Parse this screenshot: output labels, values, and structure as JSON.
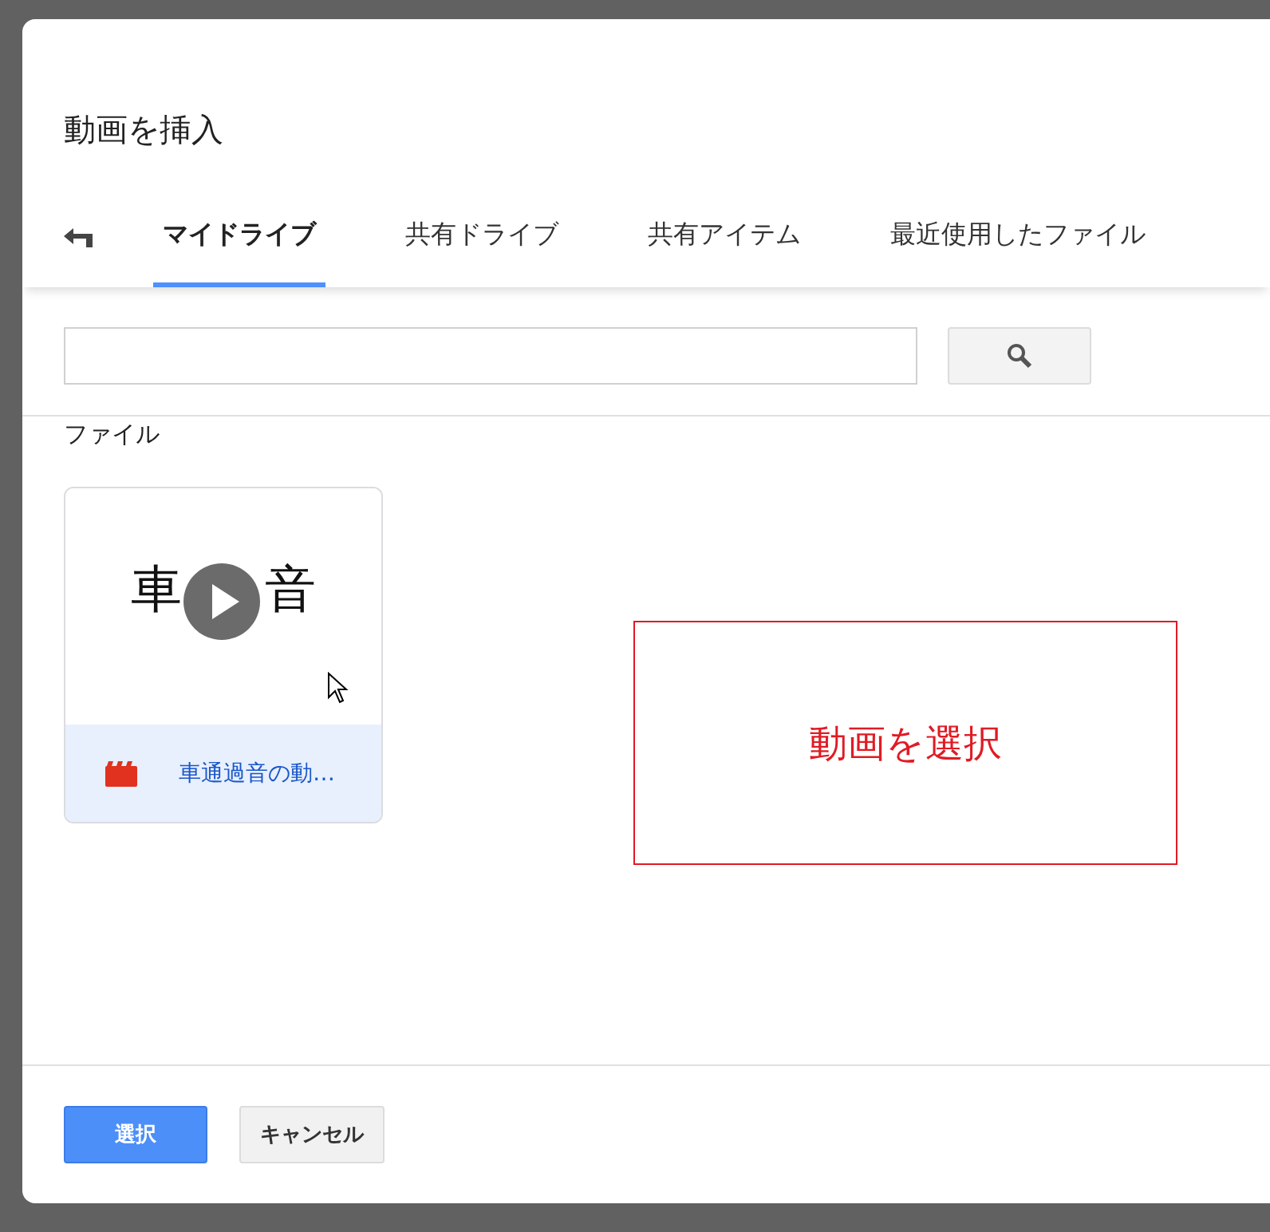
{
  "dialog": {
    "title": "動画を挿入",
    "tabs": [
      {
        "label": "マイドライブ",
        "selected": true
      },
      {
        "label": "共有ドライブ",
        "selected": false
      },
      {
        "label": "共有アイテム",
        "selected": false
      },
      {
        "label": "最近使用したファイル",
        "selected": false
      }
    ],
    "section_label": "ファイル",
    "files": [
      {
        "thumbnail_texts": [
          "車",
          "音"
        ],
        "name": "車通過音の動…"
      }
    ],
    "annotation": "動画を選択",
    "buttons": [
      {
        "label": "選択",
        "kind": "primary"
      },
      {
        "label": "キャンセル",
        "kind": "secondary"
      }
    ]
  }
}
